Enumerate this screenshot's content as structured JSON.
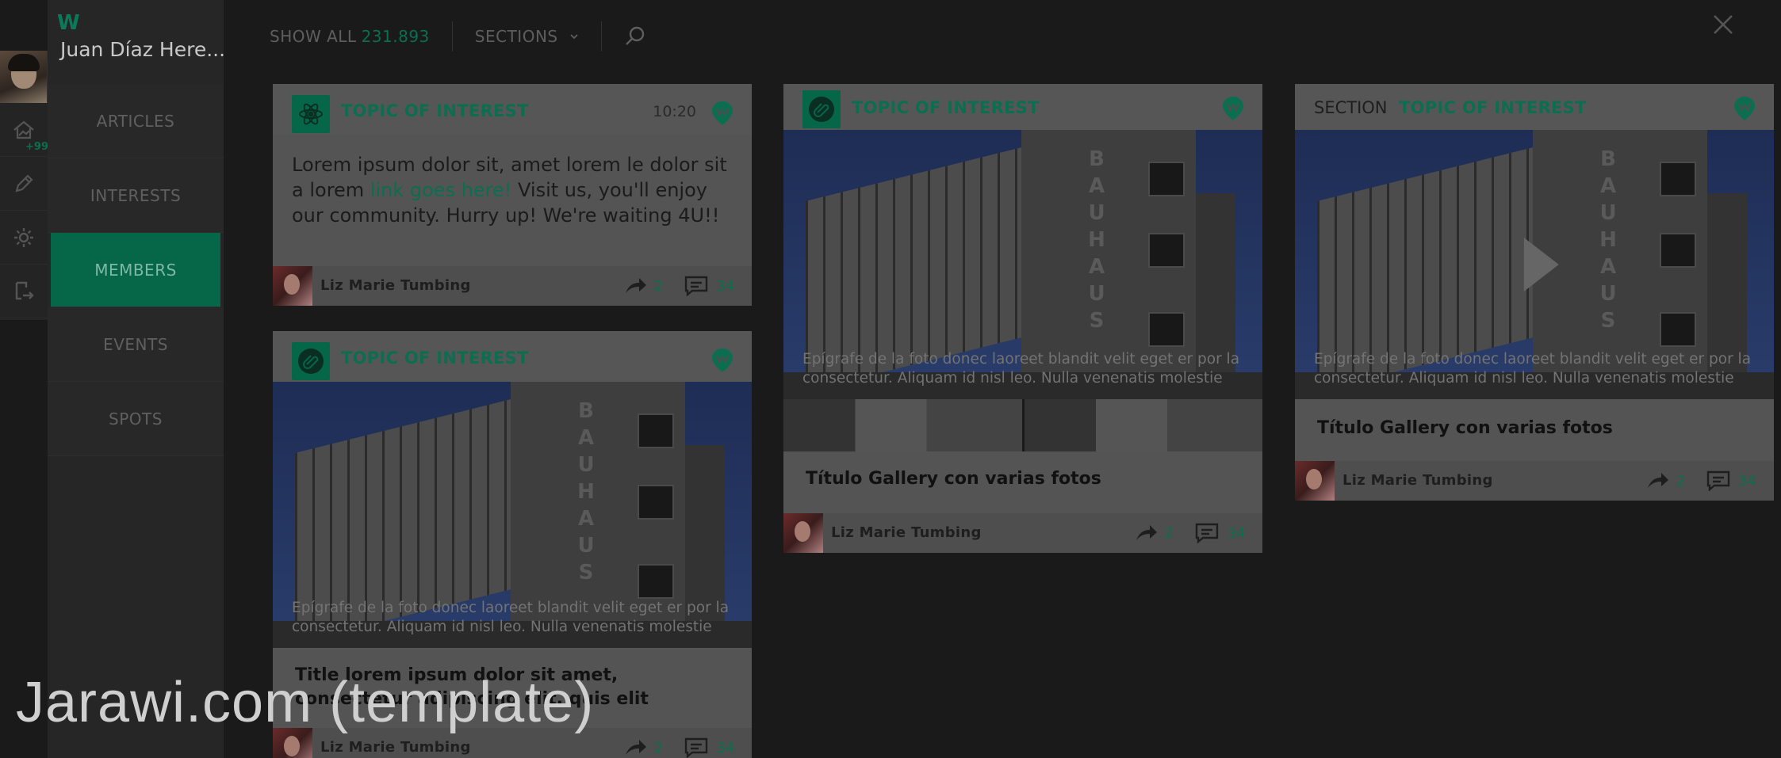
{
  "sidebar": {
    "brand": "W",
    "username": "Juan Díaz Here...",
    "badge": "+99",
    "nav": [
      {
        "label": "ARTICLES",
        "active": false
      },
      {
        "label": "INTERESTS",
        "active": false
      },
      {
        "label": "MEMBERS",
        "active": true
      },
      {
        "label": "EVENTS",
        "active": false
      },
      {
        "label": "SPOTS",
        "active": false
      }
    ]
  },
  "header": {
    "show_all_label": "SHOW ALL",
    "show_all_count": "231.893",
    "sections_label": "SECTIONS"
  },
  "cards": {
    "c1": {
      "topic": "TOPIC OF INTEREST",
      "time": "10:20",
      "text_before": "Lorem ipsum dolor sit, amet lorem le dolor sit a lorem ",
      "link": "link goes here!",
      "text_after": " Visit us, you'll enjoy our community. Hurry up! We're waiting 4U!!",
      "author": "Liz  Marie Tumbing",
      "shares": "2",
      "comments": "34"
    },
    "c2": {
      "topic": "TOPIC OF INTEREST",
      "caption": "Epígrafe de la foto donec laoreet blandit velit eget er por la consectetur. Aliquam id nisl leo. Nulla venenatis molestie",
      "title": "Title lorem ipsum dolor sit amet, consectetur adipiscing elit, quis elit",
      "author": "Liz  Marie Tumbing",
      "shares": "2",
      "comments": "34"
    },
    "c3": {
      "topic": "TOPIC OF INTEREST",
      "caption": "Epígrafe de la foto donec laoreet blandit velit eget er por la consectetur. Aliquam id nisl leo. Nulla venenatis molestie",
      "title": "Título Gallery con varias fotos",
      "author": "Liz  Marie Tumbing",
      "shares": "2",
      "comments": "34"
    },
    "c4": {
      "section": "SECTION",
      "topic": "TOPIC OF INTEREST",
      "caption": "Epígrafe de la foto donec laoreet blandit velit eget er por la consectetur. Aliquam id nisl leo. Nulla venenatis molestie",
      "title": "Título Gallery con varias fotos",
      "author": "Liz  Marie Tumbing",
      "shares": "2",
      "comments": "34"
    }
  },
  "photo_sign": [
    "B",
    "A",
    "U",
    "H",
    "A",
    "U",
    "S"
  ],
  "watermark": "Jarawi.com (template)",
  "colors": {
    "accent": "#0b6e4f",
    "background": "#1a1a1a",
    "card": "#545454"
  }
}
